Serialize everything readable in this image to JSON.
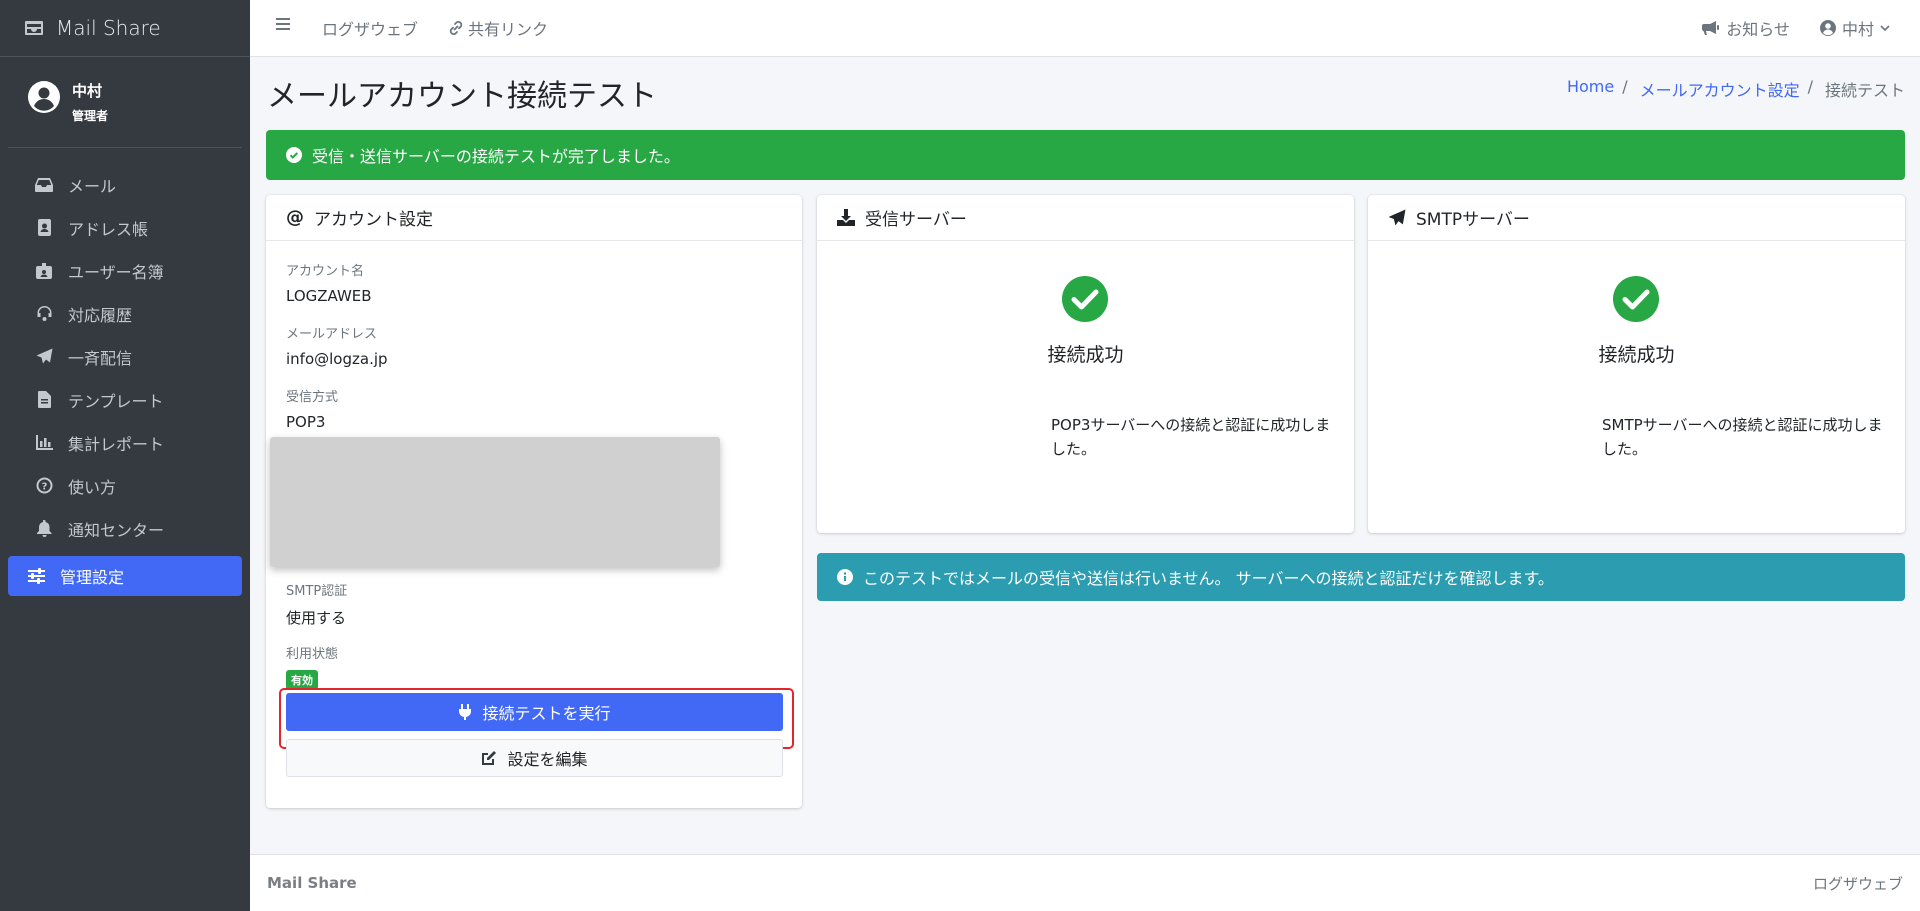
{
  "sidebar": {
    "brand": "Mail Share",
    "user": {
      "name": "中村",
      "role": "管理者"
    },
    "items": [
      {
        "label": "メール",
        "icon": "inbox-icon"
      },
      {
        "label": "アドレス帳",
        "icon": "address-book-icon"
      },
      {
        "label": "ユーザー名簿",
        "icon": "id-badge-icon"
      },
      {
        "label": "対応履歴",
        "icon": "headset-icon"
      },
      {
        "label": "一斉配信",
        "icon": "paper-plane-icon"
      },
      {
        "label": "テンプレート",
        "icon": "file-icon"
      },
      {
        "label": "集計レポート",
        "icon": "chart-bar-icon"
      },
      {
        "label": "使い方",
        "icon": "question-circle-icon"
      },
      {
        "label": "通知センター",
        "icon": "bell-icon"
      },
      {
        "label": "管理設定",
        "icon": "sliders-icon",
        "active": true
      }
    ]
  },
  "topnav": {
    "links": [
      "ログザウェブ",
      "共有リンク"
    ],
    "notifications": "お知らせ",
    "user": "中村"
  },
  "page": {
    "title": "メールアカウント接続テスト",
    "breadcrumb": [
      "Home",
      "メールアカウント設定",
      "接続テスト"
    ]
  },
  "alert_success": "受信・送信サーバーの接続テストが完了しました。",
  "account": {
    "header": "アカウント設定",
    "fields": {
      "account_name": {
        "label": "アカウント名",
        "value": "LOGZAWEB"
      },
      "email": {
        "label": "メールアドレス",
        "value": "info@logza.jp"
      },
      "receive_method": {
        "label": "受信方式",
        "value": "POP3"
      },
      "smtp_auth": {
        "label": "SMTP認証",
        "value": "使用する"
      },
      "status": {
        "label": "利用状態",
        "value": "有効"
      }
    },
    "run_button": "接続テストを実行",
    "edit_button": "設定を編集"
  },
  "incoming": {
    "header": "受信サーバー",
    "status": "接続成功",
    "message": "POP3サーバーへの接続と認証に成功しました。"
  },
  "smtp": {
    "header": "SMTPサーバー",
    "status": "接続成功",
    "message": "SMTPサーバーへの接続と認証に成功しました。"
  },
  "alert_info": "このテストではメールの受信や送信は行いません。 サーバーへの接続と認証だけを確認します。",
  "footer": {
    "brand": "Mail Share",
    "right": "ログザウェブ"
  },
  "colors": {
    "primary": "#4169f5",
    "success": "#28a745",
    "info": "#2c9db0",
    "sidebar": "#343a40",
    "highlight": "#e3262d"
  }
}
